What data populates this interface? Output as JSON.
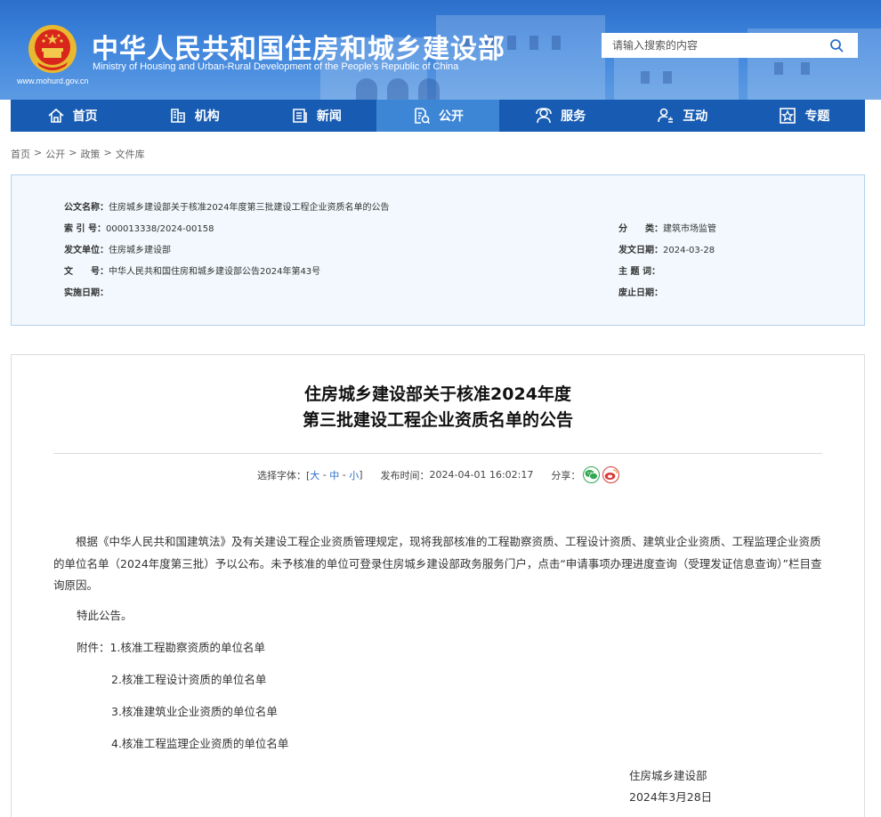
{
  "header": {
    "title_cn": "中华人民共和国住房和城乡建设部",
    "title_en": "Ministry of Housing and Urban-Rural Development of the People’s Republic of China",
    "url": "www.mohurd.gov.cn",
    "search_placeholder": "请输入搜索的内容",
    "colors": {
      "primary": "#175cb2",
      "active": "#3d86d6"
    }
  },
  "nav": [
    {
      "label": "首页",
      "icon": "home-icon"
    },
    {
      "label": "机构",
      "icon": "building-icon"
    },
    {
      "label": "新闻",
      "icon": "news-icon"
    },
    {
      "label": "公开",
      "icon": "document-icon"
    },
    {
      "label": "服务",
      "icon": "service-icon"
    },
    {
      "label": "互动",
      "icon": "interaction-icon"
    },
    {
      "label": "专题",
      "icon": "topic-icon"
    }
  ],
  "nav_active": "公开",
  "breadcrumb": [
    "首页",
    "公开",
    "政策",
    "文件库"
  ],
  "meta": {
    "doc_name_label": "公文名称：",
    "doc_name": "住房城乡建设部关于核准2024年度第三批建设工程企业资质名单的公告",
    "index_label": "索 引 号：",
    "index": "000013338/2024-00158",
    "category_label": "分　　类：",
    "category": "建筑市场监管",
    "issuer_label": "发文单位：",
    "issuer": "住房城乡建设部",
    "issue_date_label": "发文日期：",
    "issue_date": "2024-03-28",
    "doc_no_label": "文　　号：",
    "doc_no": "中华人民共和国住房和城乡建设部公告2024年第43号",
    "subject_label": "主 题 词：",
    "subject": "",
    "effective_label": "实施日期：",
    "effective": "",
    "expire_label": "废止日期：",
    "expire": ""
  },
  "article": {
    "title_line1": "住房城乡建设部关于核准2024年度",
    "title_line2": "第三批建设工程企业资质名单的公告",
    "font_label": "选择字体：[",
    "font_large": "大",
    "font_medium": "中",
    "font_small": "小",
    "font_end": "]",
    "publish_label": "发布时间：",
    "publish_time": "2024-04-01 16:02:17",
    "share_label": "分享：",
    "paragraph1": "根据《中华人民共和国建筑法》及有关建设工程企业资质管理规定，现将我部核准的工程勘察资质、工程设计资质、建筑业企业资质、工程监理企业资质的单位名单（2024年度第三批）予以公布。未予核准的单位可登录住房城乡建设部政务服务门户，点击“申请事项办理进度查询（受理发证信息查询）”栏目查询原因。",
    "notice": "特此公告。",
    "attachments_label": "附件：",
    "attachments": [
      "1.核准工程勘察资质的单位名单",
      "2.核准工程设计资质的单位名单",
      "3.核准建筑业企业资质的单位名单",
      "4.核准工程监理企业资质的单位名单"
    ],
    "signer": "住房城乡建设部",
    "sign_date": "2024年3月28日"
  }
}
